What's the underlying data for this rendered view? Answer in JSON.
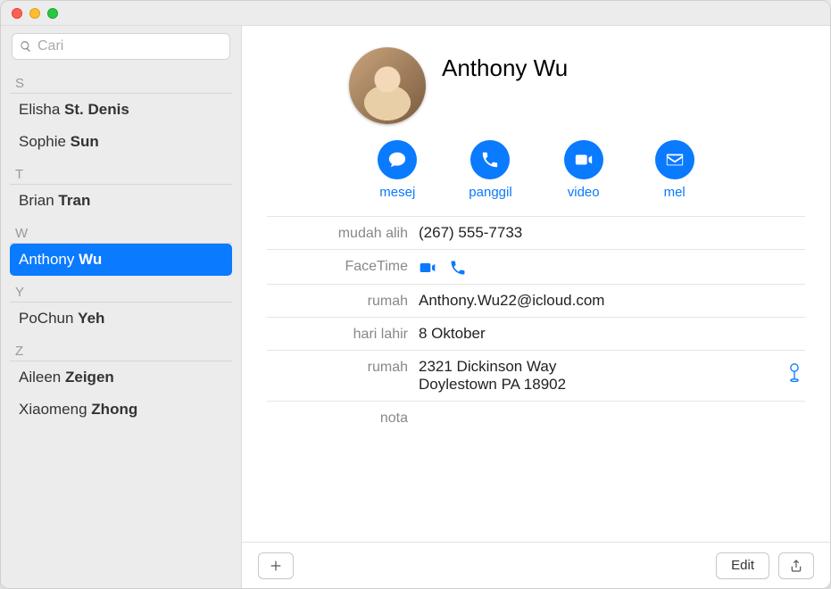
{
  "search": {
    "placeholder": "Cari"
  },
  "sidebar": {
    "sections": [
      {
        "letter": "S",
        "items": [
          {
            "first": "Elisha",
            "last": "St. Denis"
          },
          {
            "first": "Sophie",
            "last": "Sun"
          }
        ]
      },
      {
        "letter": "T",
        "items": [
          {
            "first": "Brian",
            "last": "Tran"
          }
        ]
      },
      {
        "letter": "W",
        "items": [
          {
            "first": "Anthony",
            "last": "Wu",
            "selected": true
          }
        ]
      },
      {
        "letter": "Y",
        "items": [
          {
            "first": "PoChun",
            "last": "Yeh"
          }
        ]
      },
      {
        "letter": "Z",
        "items": [
          {
            "first": "Aileen",
            "last": "Zeigen"
          },
          {
            "first": "Xiaomeng",
            "last": "Zhong"
          }
        ]
      }
    ]
  },
  "detail": {
    "name": "Anthony Wu",
    "actions": {
      "message": "mesej",
      "call": "panggil",
      "video": "video",
      "mail": "mel"
    },
    "fields": {
      "mobile_label": "mudah alih",
      "mobile_value": "(267) 555-7733",
      "facetime_label": "FaceTime",
      "home_email_label": "rumah",
      "home_email_value": "Anthony.Wu22@icloud.com",
      "birthday_label": "hari lahir",
      "birthday_value": "8 Oktober",
      "home_addr_label": "rumah",
      "home_addr_line1": "2321 Dickinson Way",
      "home_addr_line2": "Doylestown PA 18902",
      "note_label": "nota"
    }
  },
  "toolbar": {
    "edit": "Edit"
  }
}
